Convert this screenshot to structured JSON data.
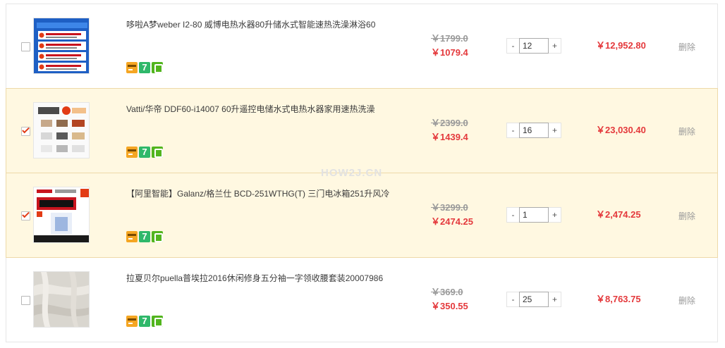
{
  "cart": {
    "items": [
      {
        "selected": false,
        "title": "哆啦A梦weber I2-80 威博电热水器80升储水式智能速热洗澡淋浴60",
        "old_price": "￥1799.0",
        "price": "￥1079.4",
        "quantity": "12",
        "subtotal": "￥12,952.80",
        "delete_label": "删除",
        "badge_icons": [
          "credit-card-icon",
          "seven-day-return-icon",
          "guarantee-icon"
        ]
      },
      {
        "selected": true,
        "title": "Vatti/华帝 DDF60-i14007 60升遥控电储水式电热水器家用速热洗澡",
        "old_price": "￥2399.0",
        "price": "￥1439.4",
        "quantity": "16",
        "subtotal": "￥23,030.40",
        "delete_label": "删除",
        "badge_icons": [
          "credit-card-icon",
          "seven-day-return-icon",
          "guarantee-icon"
        ]
      },
      {
        "selected": true,
        "title": "【阿里智能】Galanz/格兰仕 BCD-251WTHG(T) 三门电冰箱251升风冷",
        "old_price": "￥3299.0",
        "price": "￥2474.25",
        "quantity": "1",
        "subtotal": "￥2,474.25",
        "delete_label": "删除",
        "badge_icons": [
          "credit-card-icon",
          "seven-day-return-icon",
          "guarantee-icon"
        ]
      },
      {
        "selected": false,
        "title": "拉夏贝尔puella普埃拉2016休闲修身五分袖一字领收腰套装20007986",
        "old_price": "￥369.0",
        "price": "￥350.55",
        "quantity": "25",
        "subtotal": "￥8,763.75",
        "delete_label": "删除",
        "badge_icons": [
          "credit-card-icon",
          "seven-day-return-icon",
          "guarantee-icon"
        ]
      }
    ],
    "qty_minus": "-",
    "qty_plus": "+",
    "badge_seven_text": "7"
  },
  "watermark": "HOW2J.CN",
  "colors": {
    "price_red": "#e4393c",
    "selected_row_bg": "#fff8e1",
    "checkbox_tick": "#e23b15"
  }
}
